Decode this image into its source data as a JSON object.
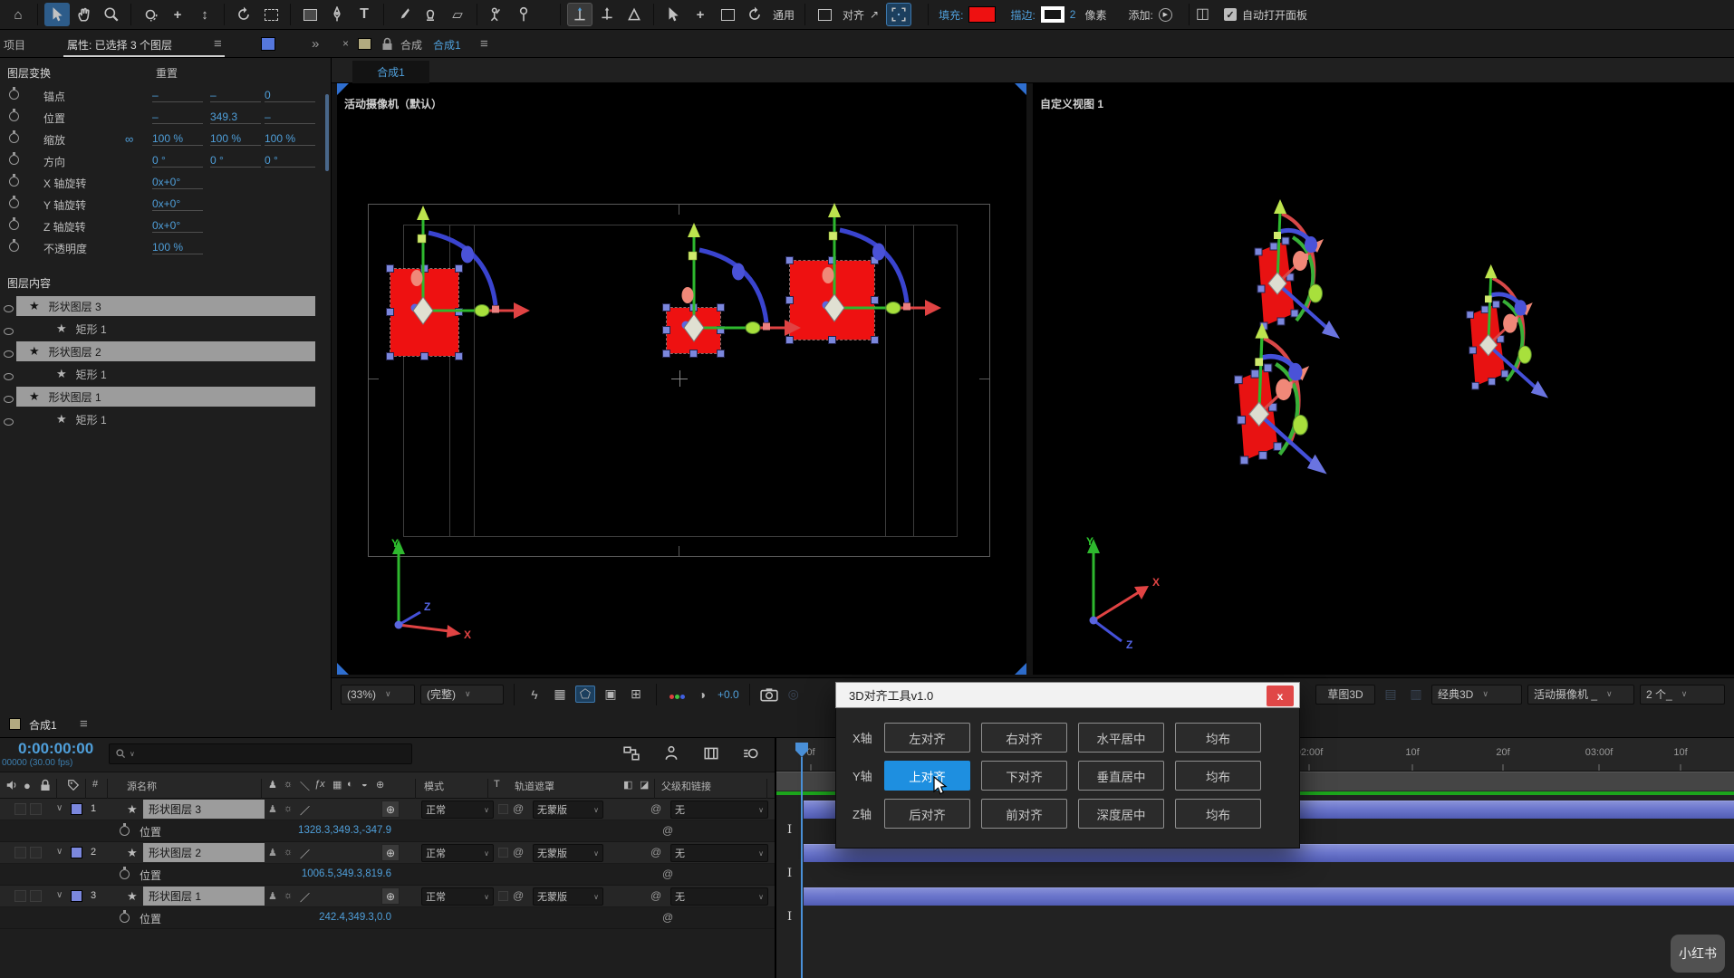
{
  "toolbar": {
    "universal": "通用",
    "align": "对齐",
    "fill": "填充:",
    "stroke": "描边:",
    "stroke_width_value": "2",
    "stroke_width_unit": "像素",
    "add": "添加:",
    "auto_open_panel": "自动打开面板",
    "text_tool": "T"
  },
  "header": {
    "project_tab": "项目",
    "properties_title": "属性: 已选择 3 个图层",
    "comp_close": "×",
    "comp_word": "合成",
    "comp_name": "合成1"
  },
  "properties": {
    "section_transform": "图层变换",
    "reset": "重置",
    "rows": [
      {
        "label": "锚点",
        "v1": "–",
        "v2": "–",
        "v3": "0"
      },
      {
        "label": "位置",
        "v1": "–",
        "v2": "349.3",
        "v3": "–"
      },
      {
        "label": "缩放",
        "v1": "100 %",
        "v2": "100 %",
        "v3": "100 %"
      },
      {
        "label": "方向",
        "v1": "0 °",
        "v2": "0 °",
        "v3": "0 °"
      },
      {
        "label": "X 轴旋转",
        "v1": "0x+0°"
      },
      {
        "label": "Y 轴旋转",
        "v1": "0x+0°"
      },
      {
        "label": "Z 轴旋转",
        "v1": "0x+0°"
      },
      {
        "label": "不透明度",
        "v1": "100 %"
      }
    ],
    "section_content": "图层内容",
    "content_rows": [
      {
        "name": "形状图层 3",
        "selected": true
      },
      {
        "name": "矩形 1",
        "selected": false
      },
      {
        "name": "形状图层 2",
        "selected": true
      },
      {
        "name": "矩形 1",
        "selected": false
      },
      {
        "name": "形状图层 1",
        "selected": true
      },
      {
        "name": "矩形 1",
        "selected": false
      }
    ]
  },
  "viewer": {
    "tab": "合成1",
    "left_label": "活动摄像机（默认）",
    "right_label": "自定义视图 1",
    "zoom": "(33%)",
    "resolution": "(完整)",
    "exposure": "+0.0",
    "draft_3d": "草图3D",
    "renderer": "经典3D",
    "camera": "活动摄像机 _",
    "views": "2 个_",
    "axis_x": "X",
    "axis_y": "Y",
    "axis_z": "Z"
  },
  "dialog": {
    "title": "3D对齐工具v1.0",
    "close": "x",
    "x_axis": "X轴",
    "y_axis": "Y轴",
    "z_axis": "Z轴",
    "x_buttons": [
      "左对齐",
      "右对齐",
      "水平居中",
      "均布"
    ],
    "y_buttons": [
      "上对齐",
      "下对齐",
      "垂直居中",
      "均布"
    ],
    "z_buttons": [
      "后对齐",
      "前对齐",
      "深度居中",
      "均布"
    ]
  },
  "timeline": {
    "tab": "合成1",
    "timecode": "0:00:00:00",
    "frame_info": "00000 (30.00 fps)",
    "col_source": "源名称",
    "col_mode": "模式",
    "col_t": "T",
    "col_matte": "轨道遮罩",
    "col_parent": "父级和链接",
    "layers": [
      {
        "num": "1",
        "name": "形状图层 3",
        "prop": "位置",
        "value": "1328.3,349.3,-347.9",
        "mode": "正常",
        "matte": "无蒙版",
        "parent": "无"
      },
      {
        "num": "2",
        "name": "形状图层 2",
        "prop": "位置",
        "value": "1006.5,349.3,819.6",
        "mode": "正常",
        "matte": "无蒙版",
        "parent": "无"
      },
      {
        "num": "3",
        "name": "形状图层 1",
        "prop": "位置",
        "value": "242.4,349.3,0.0",
        "mode": "正常",
        "matte": "无蒙版",
        "parent": "无"
      }
    ],
    "ruler": [
      "0f",
      "02:00f",
      "10f",
      "20f",
      "03:00f",
      "10f"
    ]
  },
  "watermark": "小红书",
  "colors": {
    "accent_blue": "#4f9fda",
    "active_button_blue": "#1e8fe0",
    "shape_fill_red": "#ee1111",
    "layer_bar_blue": "#6b76cc",
    "cache_green": "#1ca51c"
  }
}
